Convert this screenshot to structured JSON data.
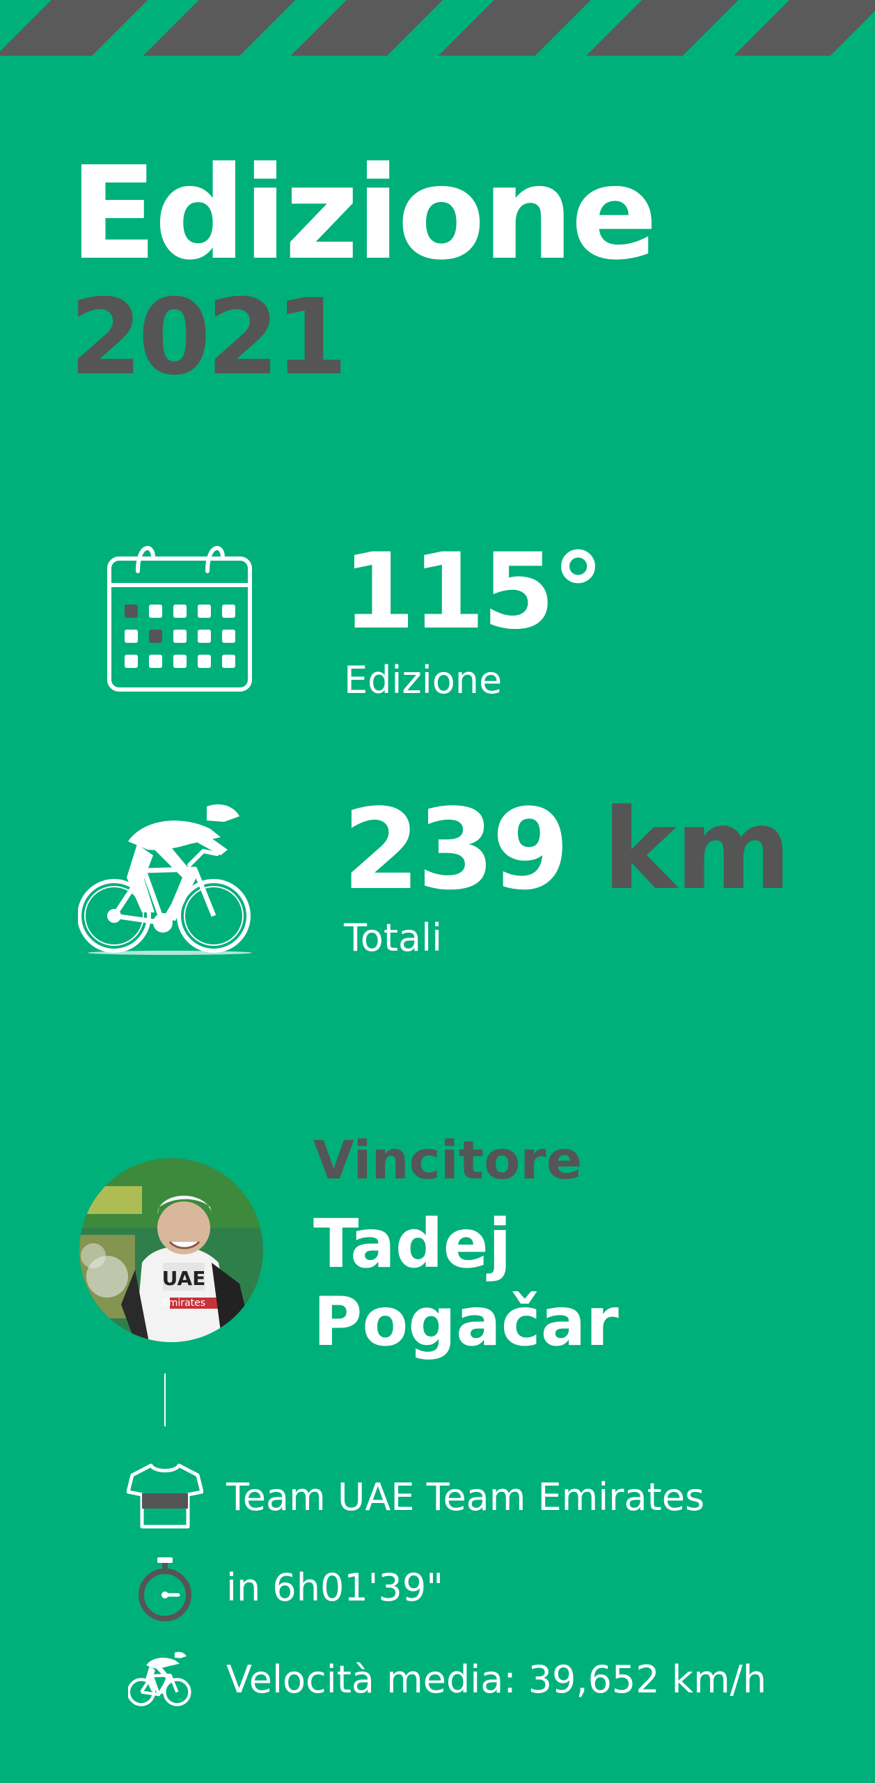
{
  "header": {
    "title": "Edizione",
    "year": "2021"
  },
  "stats": {
    "edition_number": "115°",
    "edition_label": "Edizione",
    "distance_value": "239",
    "distance_unit": "km",
    "distance_label": "Totali"
  },
  "winner": {
    "label": "Vincitore",
    "name_line1": "Tadej",
    "name_line2": "Pogačar",
    "details": {
      "team": "Team UAE Team Emirates",
      "time": "in 6h01'39\"",
      "speed": "Velocità media: 39,652 km/h"
    }
  },
  "colors": {
    "background": "#00B07A",
    "accent_dark": "#555555",
    "text": "#FFFFFF"
  },
  "icons": [
    "calendar-icon",
    "cyclist-icon",
    "jersey-icon",
    "stopwatch-icon",
    "cyclist-small-icon"
  ]
}
